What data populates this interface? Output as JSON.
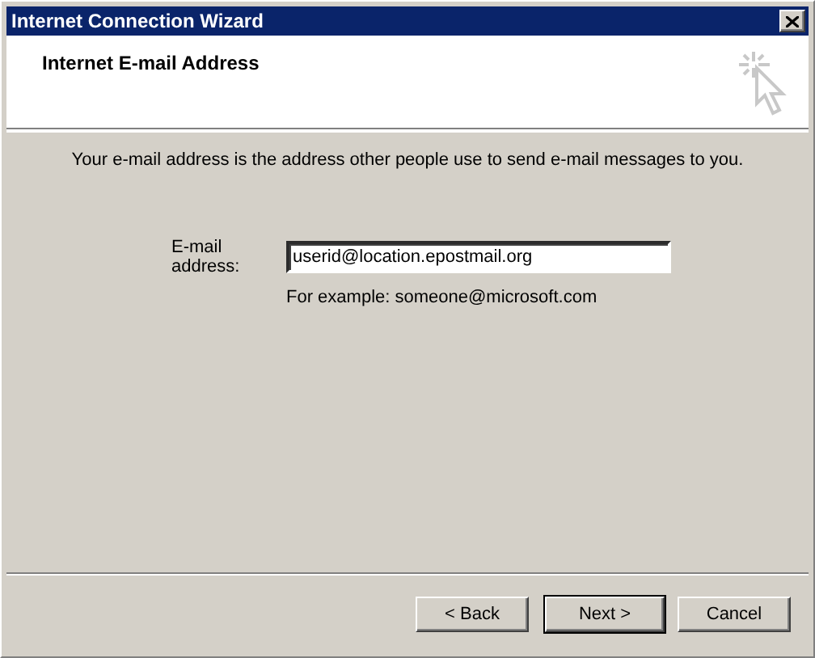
{
  "window": {
    "title": "Internet Connection Wizard"
  },
  "header": {
    "title": "Internet E-mail Address"
  },
  "intro": "Your e-mail address is the address other people use to send e-mail messages to you.",
  "email": {
    "label": "E-mail address:",
    "value": "userid@location.epostmail.org",
    "example": "For example: someone@microsoft.com"
  },
  "buttons": [
    {
      "label": "< Back",
      "default": false
    },
    {
      "label": "Next >",
      "default": true
    },
    {
      "label": "Cancel",
      "default": false
    }
  ]
}
